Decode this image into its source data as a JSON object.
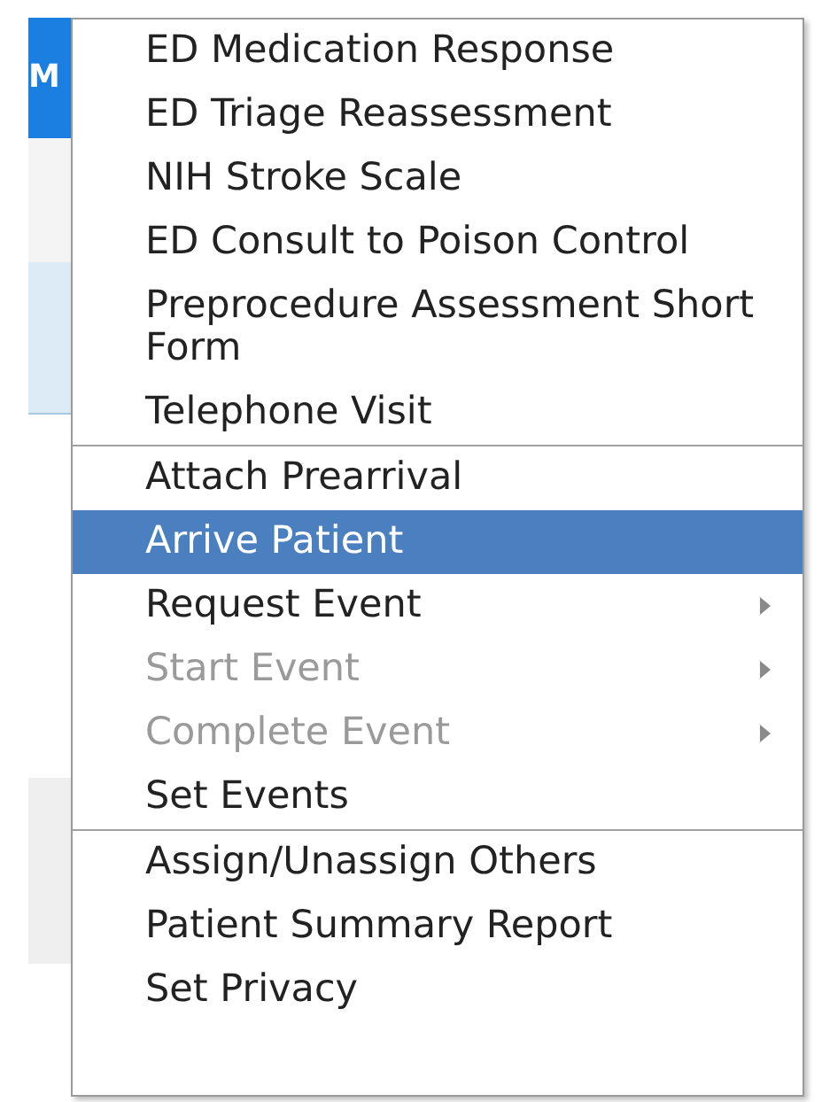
{
  "side_tab": {
    "label": "M"
  },
  "menu": {
    "groups": [
      {
        "items": [
          {
            "label": "ED Medication Response",
            "selected": false,
            "disabled": false,
            "submenu": false
          },
          {
            "label": "ED Triage Reassessment",
            "selected": false,
            "disabled": false,
            "submenu": false
          },
          {
            "label": "NIH Stroke Scale",
            "selected": false,
            "disabled": false,
            "submenu": false
          },
          {
            "label": "ED Consult to Poison Control",
            "selected": false,
            "disabled": false,
            "submenu": false
          },
          {
            "label": "Preprocedure Assessment Short Form",
            "selected": false,
            "disabled": false,
            "submenu": false
          },
          {
            "label": "Telephone Visit",
            "selected": false,
            "disabled": false,
            "submenu": false
          }
        ]
      },
      {
        "items": [
          {
            "label": "Attach Prearrival",
            "selected": false,
            "disabled": false,
            "submenu": false
          },
          {
            "label": "Arrive Patient",
            "selected": true,
            "disabled": false,
            "submenu": false
          },
          {
            "label": "Request Event",
            "selected": false,
            "disabled": false,
            "submenu": true
          },
          {
            "label": "Start Event",
            "selected": false,
            "disabled": true,
            "submenu": true
          },
          {
            "label": "Complete Event",
            "selected": false,
            "disabled": true,
            "submenu": true
          },
          {
            "label": "Set Events",
            "selected": false,
            "disabled": false,
            "submenu": false
          }
        ]
      },
      {
        "items": [
          {
            "label": "Assign/Unassign Others",
            "selected": false,
            "disabled": false,
            "submenu": false
          },
          {
            "label": "Patient Summary Report",
            "selected": false,
            "disabled": false,
            "submenu": false
          },
          {
            "label": "Set Privacy",
            "selected": false,
            "disabled": false,
            "submenu": false
          }
        ]
      }
    ]
  }
}
